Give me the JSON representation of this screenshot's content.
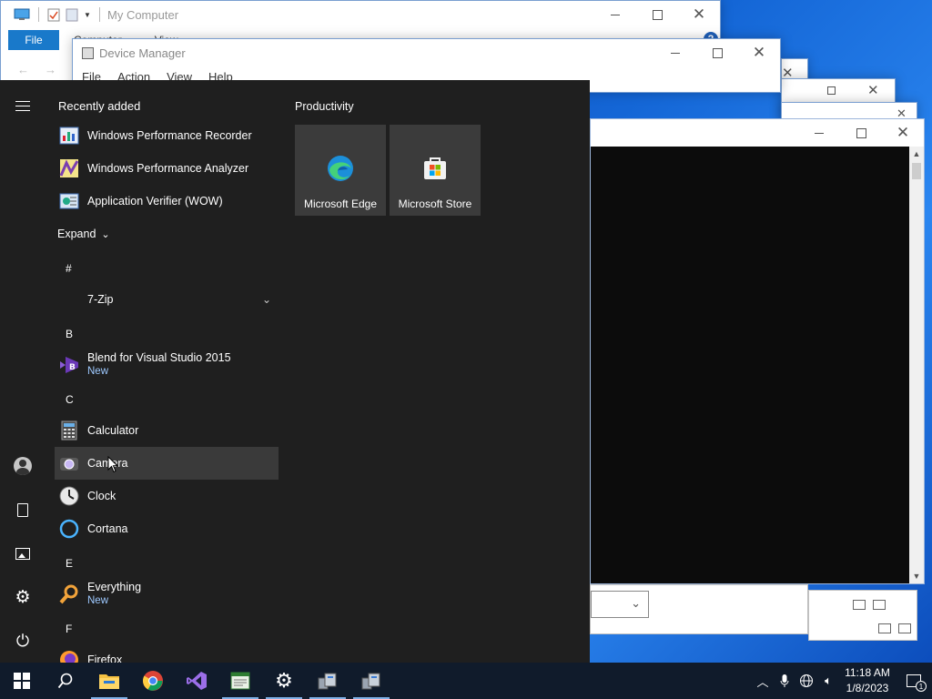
{
  "background_windows": {
    "my_computer": {
      "title": "My Computer",
      "file_tab": "File",
      "tabs": [
        "Computer",
        "View"
      ]
    },
    "device_manager": {
      "title": "Device Manager",
      "menu": [
        "File",
        "Action",
        "View",
        "Help"
      ]
    }
  },
  "start_menu": {
    "recently_added_heading": "Recently added",
    "recently_added": [
      {
        "name": "Windows Performance Recorder",
        "icon": "performance-recorder-icon"
      },
      {
        "name": "Windows Performance Analyzer",
        "icon": "performance-analyzer-icon"
      },
      {
        "name": "Application Verifier (WOW)",
        "icon": "app-verifier-icon"
      }
    ],
    "expand_label": "Expand",
    "groups": {
      "hash": "#",
      "b": "B",
      "c": "C",
      "e": "E",
      "f": "F"
    },
    "apps": {
      "seven_zip": "7-Zip",
      "blend": "Blend for Visual Studio 2015",
      "blend_badge": "New",
      "calculator": "Calculator",
      "camera": "Camera",
      "clock": "Clock",
      "cortana": "Cortana",
      "everything": "Everything",
      "everything_badge": "New",
      "firefox": "Firefox"
    },
    "tiles_heading": "Productivity",
    "tiles": [
      {
        "label": "Microsoft Edge",
        "icon": "edge-icon"
      },
      {
        "label": "Microsoft Store",
        "icon": "store-icon"
      }
    ]
  },
  "taskbar": {
    "time": "11:18 AM",
    "date": "1/8/2023",
    "notification_count": "1",
    "pinned": [
      "file-explorer-icon",
      "chrome-icon",
      "visual-studio-icon",
      "notepad-icon",
      "settings-icon",
      "server-manager-icon",
      "server-manager-icon"
    ]
  },
  "colors": {
    "start_bg": "#1f1f1f",
    "taskbar_bg": "#101b2b",
    "accent": "#1979ca",
    "new_badge": "#9ec9ff"
  }
}
